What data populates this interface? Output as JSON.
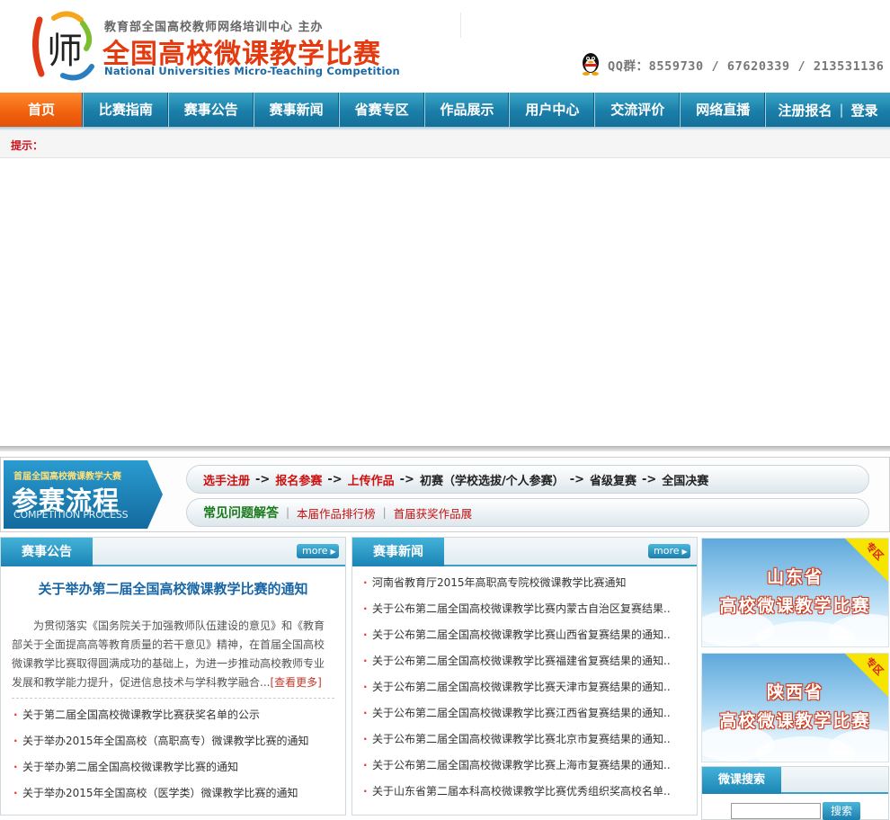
{
  "header": {
    "org_line": "教育部全国高校教师网络培训中心 主办",
    "title": "全国高校微课教学比赛",
    "title_en": "National Universities Micro-Teaching Competition",
    "logo_char": "师",
    "qq_text": "QQ群：8559730 / 67620339 / 213531136"
  },
  "nav": {
    "items": [
      "首页",
      "比赛指南",
      "赛事公告",
      "赛事新闻",
      "省赛专区",
      "作品展示",
      "用户中心",
      "交流评价",
      "网络直播"
    ],
    "register": "注册报名",
    "login": "登录"
  },
  "notice_bar": {
    "label": "提示："
  },
  "process": {
    "badge_top": "首届全国高校微课教学大赛",
    "badge_main": "参赛流程",
    "badge_en": "COMPETITION PROCESS",
    "steps": [
      "选手注册",
      "报名参赛",
      "上传作品",
      "初赛（学校选拔/个人参赛）",
      "省级复赛",
      "全国决赛"
    ],
    "arrow": "->",
    "faq_title": "常见问题解答",
    "faq_links": [
      "本届作品排行榜",
      "首届获奖作品展"
    ]
  },
  "announcements": {
    "tab": "赛事公告",
    "more": "more",
    "headline": "关于举办第二届全国高校微课教学比赛的通知",
    "summary": "为贯彻落实《国务院关于加强教师队伍建设的意见》和《教育部关于全面提高高等教育质量的若干意见》精神，在首届全国高校微课教学比赛取得圆满成功的基础上，为进一步推动高校教师专业发展和教学能力提升，促进信息技术与学科教学融合...",
    "read_more": "[查看更多]",
    "items": [
      "关于第二届全国高校微课教学比赛获奖名单的公示",
      "关于举办2015年全国高校（高职高专）微课教学比赛的通知",
      "关于举办第二届全国高校微课教学比赛的通知",
      "关于举办2015年全国高校（医学类）微课教学比赛的通知"
    ]
  },
  "news": {
    "tab": "赛事新闻",
    "more": "more",
    "items": [
      "河南省教育厅2015年高职高专院校微课教学比赛通知",
      "关于公布第二届全国高校微课教学比赛内蒙古自治区复赛结果..",
      "关于公布第二届全国高校微课教学比赛山西省复赛结果的通知..",
      "关于公布第二届全国高校微课教学比赛福建省复赛结果的通知..",
      "关于公布第二届全国高校微课教学比赛天津市复赛结果的通知..",
      "关于公布第二届全国高校微课教学比赛江西省复赛结果的通知..",
      "关于公布第二届全国高校微课教学比赛北京市复赛结果的通知..",
      "关于公布第二届全国高校微课教学比赛上海市复赛结果的通知..",
      "关于山东省第二届本科高校微课教学比赛优秀组织奖高校名单.."
    ]
  },
  "zones": [
    {
      "province": "山东省",
      "subtitle": "高校微课教学比赛",
      "corner": "专区"
    },
    {
      "province": "陕西省",
      "subtitle": "高校微课教学比赛",
      "corner": "专区"
    }
  ],
  "search": {
    "tab": "微课搜索",
    "button": "搜索"
  }
}
